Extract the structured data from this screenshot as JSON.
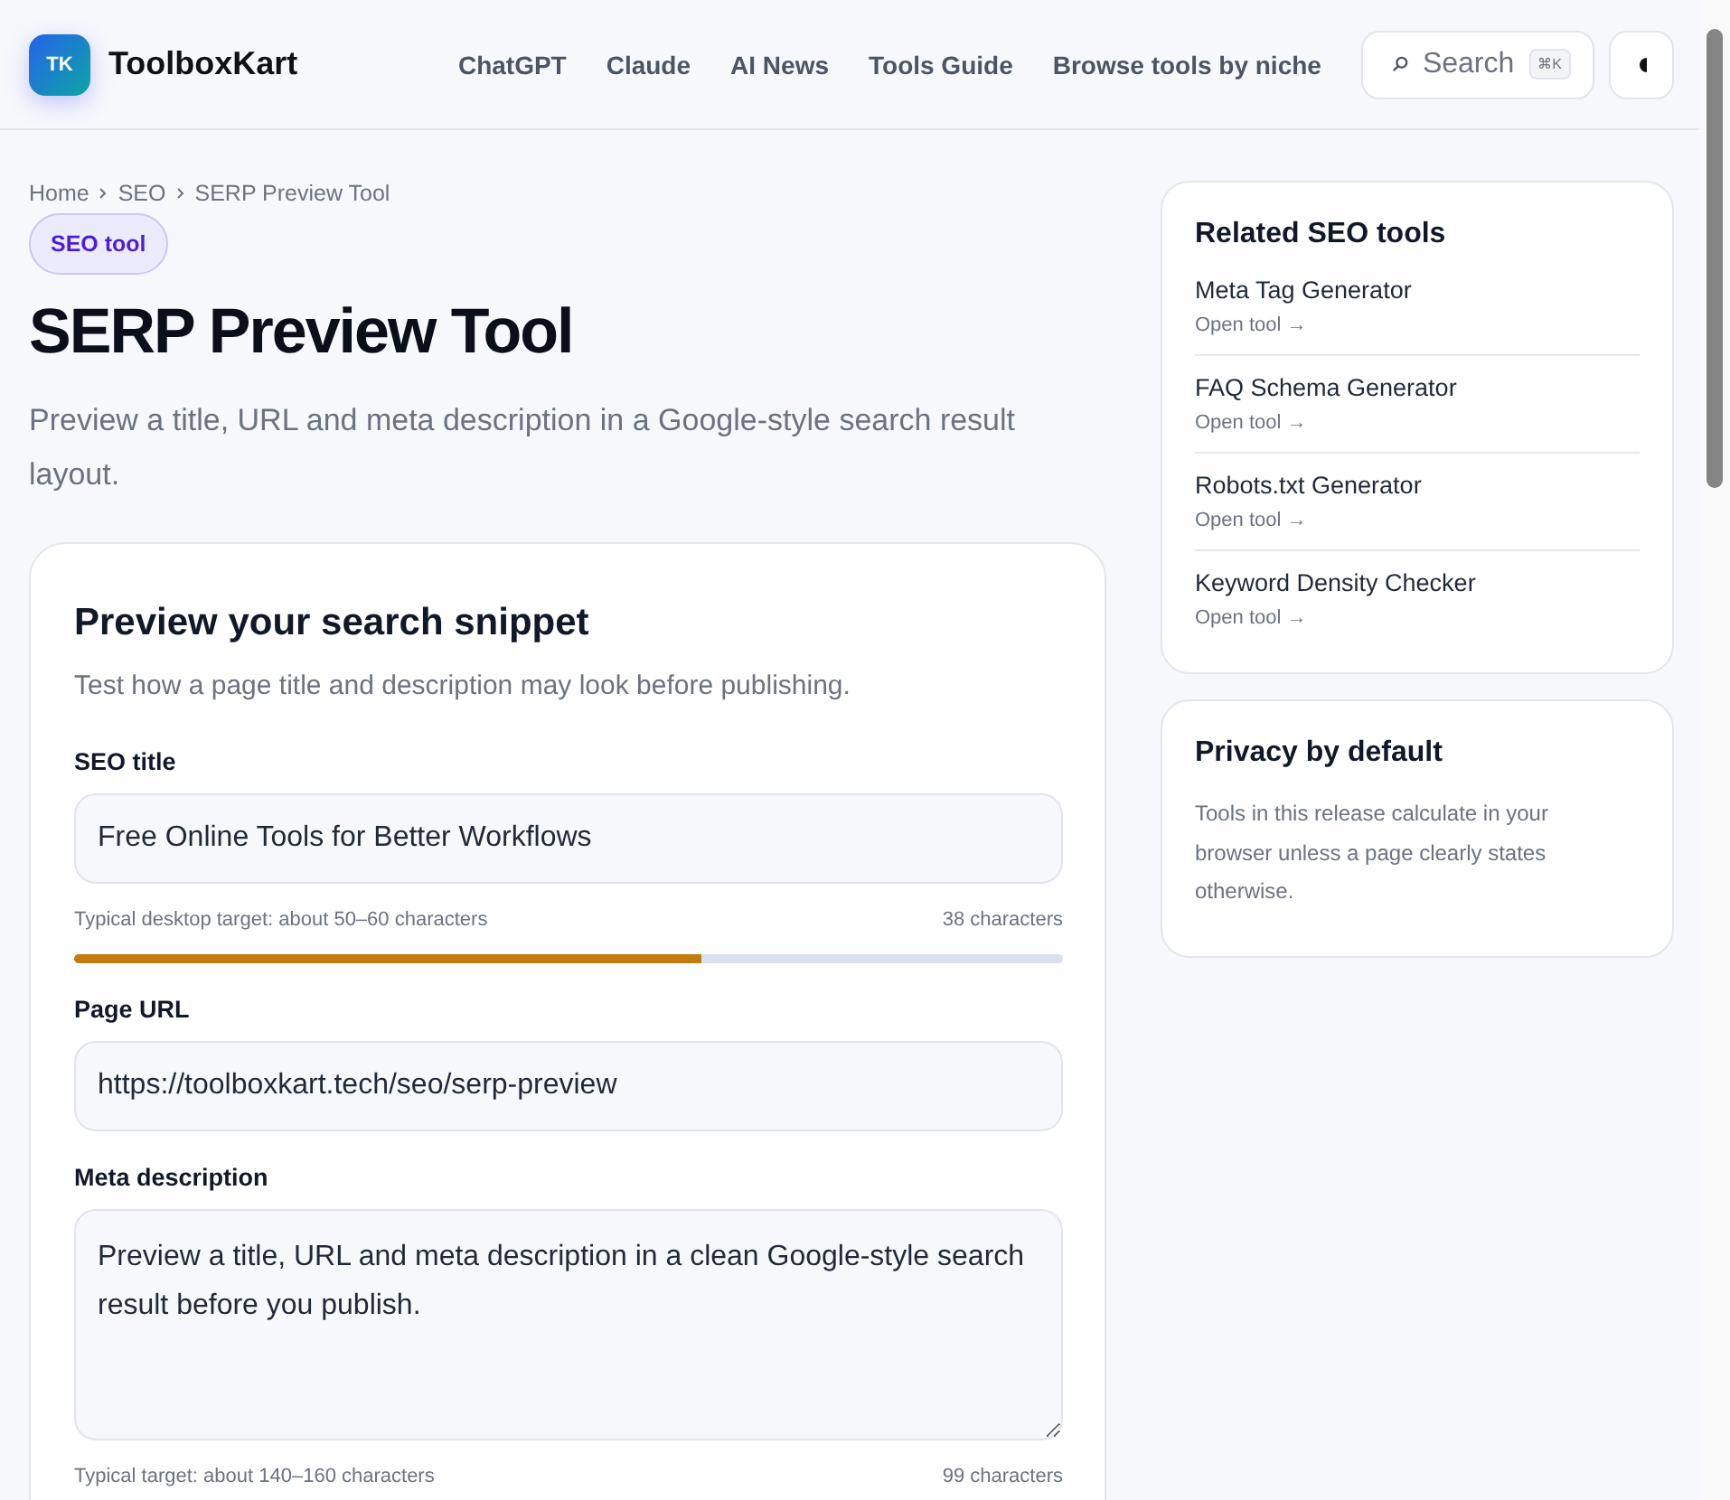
{
  "header": {
    "logo_mark": "TK",
    "brand": "ToolboxKart",
    "nav": [
      {
        "label": "ChatGPT"
      },
      {
        "label": "Claude"
      },
      {
        "label": "AI News"
      },
      {
        "label": "Tools Guide"
      },
      {
        "label": "Browse tools by niche"
      }
    ],
    "search": {
      "label": "Search",
      "shortcut": "⌘K"
    }
  },
  "breadcrumb": [
    "Home",
    "SEO",
    "SERP Preview Tool"
  ],
  "badge": "SEO tool",
  "title": "SERP Preview Tool",
  "subtitle": "Preview a title, URL and meta description in a Google-style search result layout.",
  "form": {
    "heading": "Preview your search snippet",
    "intro": "Test how a page title and description may look before publishing.",
    "fields": [
      {
        "kind": "input",
        "label": "SEO title",
        "value": "Free Online Tools for Better Workflows",
        "hint": "Typical desktop target: about 50–60 characters",
        "count": "38 characters",
        "level": 0.635
      },
      {
        "kind": "input",
        "label": "Page URL",
        "value": "https://toolboxkart.tech/seo/serp-preview"
      },
      {
        "kind": "textarea",
        "label": "Meta description",
        "value": "Preview a title, URL and meta description in a clean Google-style search result before you publish.",
        "hint": "Typical target: about 140–160 characters",
        "count": "99 characters"
      }
    ]
  },
  "related": {
    "heading": "Related SEO tools",
    "items": [
      {
        "name": "Meta Tag Generator",
        "link": "Open tool →"
      },
      {
        "name": "FAQ Schema Generator",
        "link": "Open tool →"
      },
      {
        "name": "Robots.txt Generator",
        "link": "Open tool →"
      },
      {
        "name": "Keyword Density Checker",
        "link": "Open tool →"
      }
    ]
  },
  "privacy": {
    "heading": "Privacy by default",
    "text": "Tools in this release calculate in your browser unless a page clearly states otherwise."
  }
}
